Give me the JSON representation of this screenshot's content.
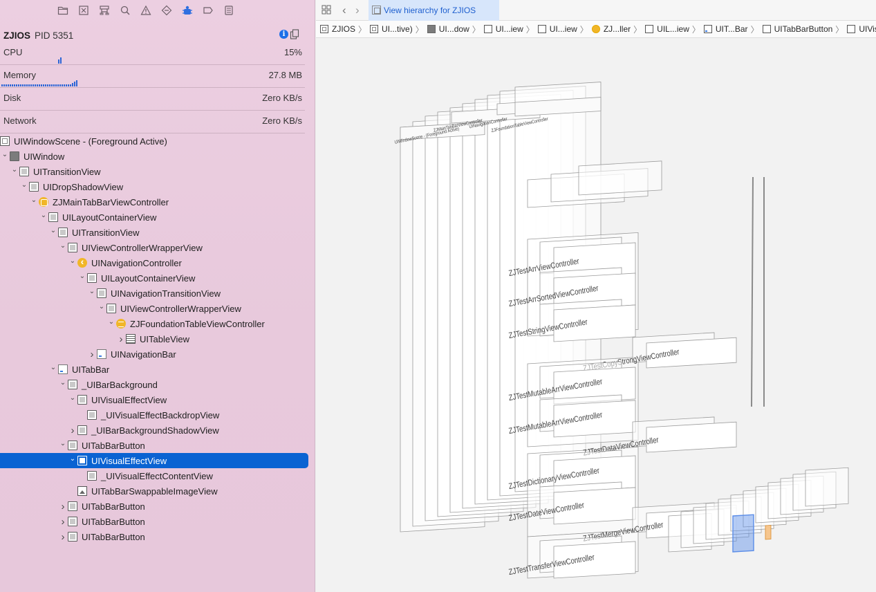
{
  "navigator": {
    "toolbar_icons": [
      "folder-icon",
      "source-control-icon",
      "symbol-icon",
      "find-icon",
      "issue-icon",
      "test-icon",
      "debug-icon",
      "breakpoint-icon",
      "report-icon"
    ],
    "process": {
      "name": "ZJIOS",
      "pid": "PID 5351"
    },
    "gauges": [
      {
        "label": "CPU",
        "value": "15%",
        "level": 0.15
      },
      {
        "label": "Memory",
        "value": "27.8 MB",
        "level": 0.5
      },
      {
        "label": "Disk",
        "value": "Zero KB/s"
      },
      {
        "label": "Network",
        "value": "Zero KB/s"
      }
    ],
    "tree": [
      {
        "label": "UIWindowScene - (Foreground Active)",
        "icon": "scene",
        "depth": 0,
        "disclosure": "none"
      },
      {
        "label": "UIWindow",
        "icon": "window",
        "depth": 0,
        "disclosure": "open"
      },
      {
        "label": "UITransitionView",
        "icon": "view",
        "depth": 1,
        "disclosure": "open"
      },
      {
        "label": "UIDropShadowView",
        "icon": "view",
        "depth": 2,
        "disclosure": "open"
      },
      {
        "label": "ZJMainTabBarViewController",
        "icon": "vc",
        "depth": 3,
        "disclosure": "open"
      },
      {
        "label": "UILayoutContainerView",
        "icon": "view",
        "depth": 4,
        "disclosure": "open"
      },
      {
        "label": "UITransitionView",
        "icon": "view",
        "depth": 5,
        "disclosure": "open"
      },
      {
        "label": "UIViewControllerWrapperView",
        "icon": "view",
        "depth": 6,
        "disclosure": "open"
      },
      {
        "label": "UINavigationController",
        "icon": "navc",
        "depth": 7,
        "disclosure": "open"
      },
      {
        "label": "UILayoutContainerView",
        "icon": "view",
        "depth": 8,
        "disclosure": "open"
      },
      {
        "label": "UINavigationTransitionView",
        "icon": "view",
        "depth": 9,
        "disclosure": "open"
      },
      {
        "label": "UIViewControllerWrapperView",
        "icon": "view",
        "depth": 10,
        "disclosure": "open"
      },
      {
        "label": "ZJFoundationTableViewController",
        "icon": "tvc",
        "depth": 11,
        "disclosure": "open"
      },
      {
        "label": "UITableView",
        "icon": "table",
        "depth": 12,
        "disclosure": "closed"
      },
      {
        "label": "UINavigationBar",
        "icon": "bar",
        "depth": 9,
        "disclosure": "closed"
      },
      {
        "label": "UITabBar",
        "icon": "bar",
        "depth": 5,
        "disclosure": "open"
      },
      {
        "label": "_UIBarBackground",
        "icon": "view",
        "depth": 6,
        "disclosure": "open"
      },
      {
        "label": "UIVisualEffectView",
        "icon": "view",
        "depth": 7,
        "disclosure": "open"
      },
      {
        "label": "_UIVisualEffectBackdropView",
        "icon": "view",
        "depth": 8,
        "disclosure": "none"
      },
      {
        "label": "_UIBarBackgroundShadowView",
        "icon": "view",
        "depth": 7,
        "disclosure": "closed"
      },
      {
        "label": "UITabBarButton",
        "icon": "view",
        "depth": 6,
        "disclosure": "open"
      },
      {
        "label": "UIVisualEffectView",
        "icon": "view",
        "depth": 7,
        "disclosure": "open",
        "selected": true
      },
      {
        "label": "_UIVisualEffectContentView",
        "icon": "view",
        "depth": 8,
        "disclosure": "none"
      },
      {
        "label": "UITabBarSwappableImageView",
        "icon": "image",
        "depth": 7,
        "disclosure": "none"
      },
      {
        "label": "UITabBarButton",
        "icon": "view",
        "depth": 6,
        "disclosure": "closed"
      },
      {
        "label": "UITabBarButton",
        "icon": "view",
        "depth": 6,
        "disclosure": "closed"
      },
      {
        "label": "UITabBarButton",
        "icon": "view",
        "depth": 6,
        "disclosure": "closed"
      }
    ]
  },
  "editor": {
    "tab_title": "View hierarchy for ZJIOS",
    "breadcrumbs": [
      {
        "label": "ZJIOS",
        "icon": "scene"
      },
      {
        "label": "UI...tive)",
        "icon": "scene"
      },
      {
        "label": "UI...dow",
        "icon": "window"
      },
      {
        "label": "UI...iew",
        "icon": "view"
      },
      {
        "label": "UI...iew",
        "icon": "view"
      },
      {
        "label": "ZJ...ller",
        "icon": "vc"
      },
      {
        "label": "UIL...iew",
        "icon": "view"
      },
      {
        "label": "UIT...Bar",
        "icon": "bar"
      },
      {
        "label": "UITabBarButton",
        "icon": "view"
      },
      {
        "label": "UIVisualEffectV",
        "icon": "view"
      }
    ],
    "canvas": {
      "layer_titles": [
        "UIWindowScene - (Foreground Active)",
        "ZJMainTabBarViewController",
        "UINavigationController",
        "ZJFoundationTableViewController"
      ],
      "cell_labels": [
        "ZJTestArrViewController",
        "ZJTestArrSortedViewController",
        "ZJTestStringViewController",
        "ZJTestCopyStrongViewController",
        "ZJTestMutableArrViewController",
        "ZJTestMutableArrViewController",
        "ZJTestDataViewController",
        "ZJTestDictionaryViewController",
        "ZJTestDateViewController",
        "ZJTestMergeViewController",
        "ZJTestTransferViewController"
      ],
      "accent_color": "#5b8de8"
    }
  }
}
